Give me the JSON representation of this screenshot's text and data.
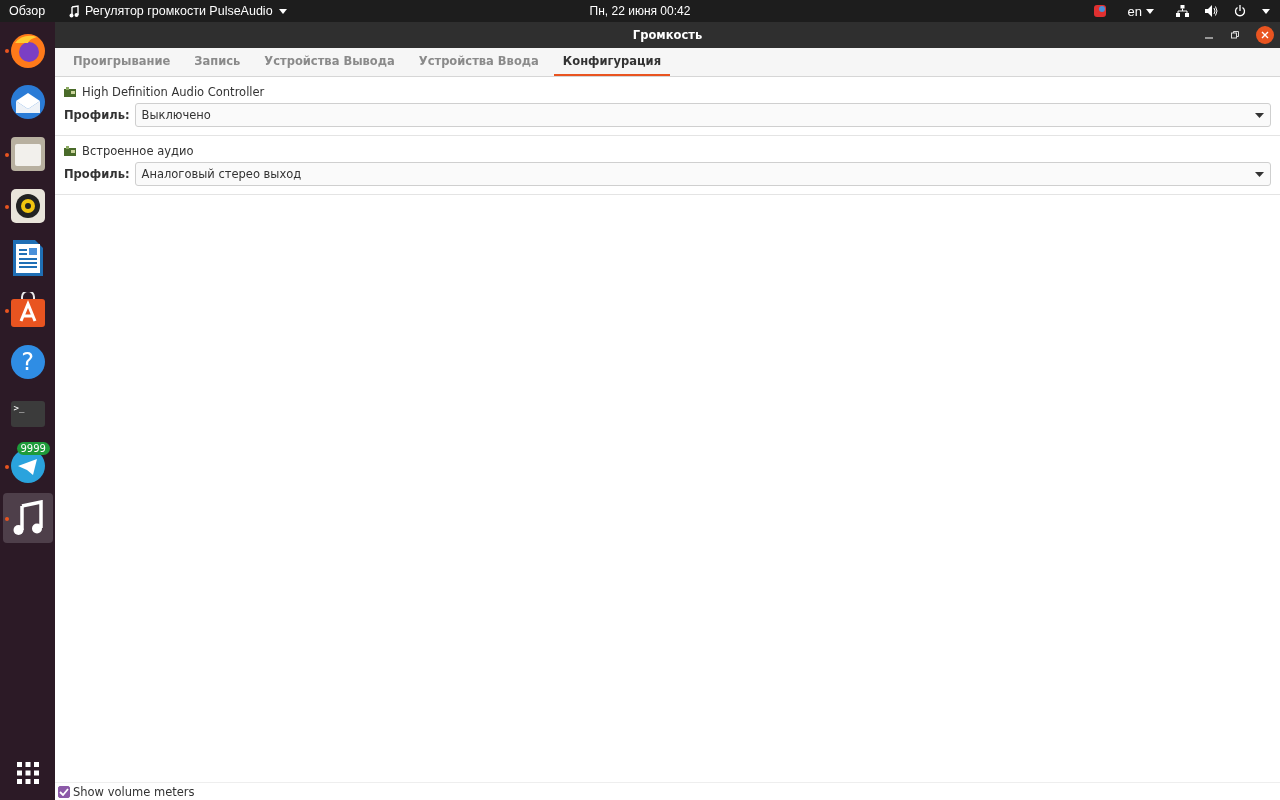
{
  "top_bar": {
    "activities": "Обзор",
    "app_menu": "Регулятор громкости PulseAudio",
    "clock": "Пн, 22 июня  00:42",
    "language": "en"
  },
  "dock": [
    {
      "kind": "firefox",
      "running": true,
      "selected": false
    },
    {
      "kind": "mail",
      "running": false,
      "selected": false
    },
    {
      "kind": "files",
      "running": true,
      "selected": false
    },
    {
      "kind": "speaker",
      "running": true,
      "selected": false
    },
    {
      "kind": "document",
      "running": false,
      "selected": false
    },
    {
      "kind": "store",
      "running": true,
      "selected": false
    },
    {
      "kind": "help",
      "running": false,
      "selected": false,
      "glyph": "?"
    },
    {
      "kind": "terminal",
      "running": false,
      "selected": false,
      "glyph": ">_"
    },
    {
      "kind": "telegram",
      "running": true,
      "selected": false,
      "badge": "9999"
    },
    {
      "kind": "music",
      "running": true,
      "selected": true
    }
  ],
  "window": {
    "title": "Громкость"
  },
  "tabs": [
    {
      "label": "Проигрывание",
      "selected": false
    },
    {
      "label": "Запись",
      "selected": false
    },
    {
      "label": "Устройства Вывода",
      "selected": false
    },
    {
      "label": "Устройства Ввода",
      "selected": false
    },
    {
      "label": "Конфигурация",
      "selected": true
    }
  ],
  "cards": [
    {
      "name": "High Definition Audio Controller",
      "profile_label": "Профиль:",
      "profile": "Выключено"
    },
    {
      "name": "Встроенное аудио",
      "profile_label": "Профиль:",
      "profile": "Аналоговый стерео выход"
    }
  ],
  "show_volume_meters": {
    "label": "Show volume meters",
    "checked": true
  }
}
